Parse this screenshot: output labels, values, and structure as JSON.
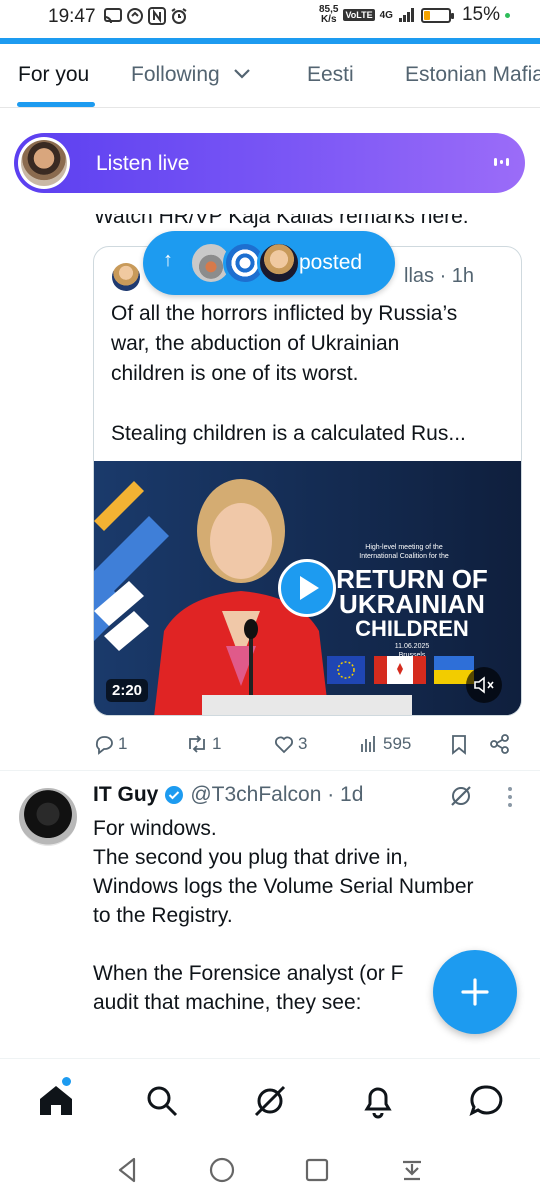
{
  "status_bar": {
    "time": "19:47",
    "net_speed_value": "85,5",
    "net_speed_unit": "K/s",
    "volte": "VoLTE",
    "signal": "4G",
    "battery_pct": "15%"
  },
  "tabs": [
    {
      "label": "For you",
      "active": true
    },
    {
      "label": "Following",
      "active": false
    },
    {
      "label": "Eesti",
      "active": false
    },
    {
      "label": "Estonian Mafia",
      "active": false
    }
  ],
  "listen_live": {
    "label": "Listen live"
  },
  "post1": {
    "partial_text": "Watch HR/VP Kaja Kallas remarks here:",
    "quote": {
      "handle_suffix": "llas · 1h",
      "text_lines": [
        "Of all the horrors inflicted by Russia’s",
        "war, the abduction of Ukrainian",
        "children is one of its worst."
      ],
      "text_line_2": "Stealing children is a calculated Rus...",
      "video": {
        "duration": "2:20",
        "banner_small": "High-level meeting of the International Coalition for the",
        "banner_big": "RETURN OF UKRAINIAN CHILDREN",
        "banner_date": "11.06.2025 Brussels"
      }
    },
    "actions": {
      "replies": "1",
      "reposts": "1",
      "likes": "3",
      "views": "595"
    }
  },
  "posted_pill": {
    "label": "posted"
  },
  "post2": {
    "name": "IT Guy",
    "handle_time": "@T3chFalcon · 1d",
    "lines": [
      "For windows.",
      "The second you plug that drive in,",
      "Windows logs the Volume Serial Number",
      "to the Registry."
    ],
    "lines_2": [
      "When the Forensice analyst (or F",
      "audit that machine, they see:"
    ]
  },
  "colors": {
    "accent": "#1d9bf0",
    "listen_gradient_start": "#5b3ff0",
    "listen_gradient_end": "#9b6cf8"
  }
}
